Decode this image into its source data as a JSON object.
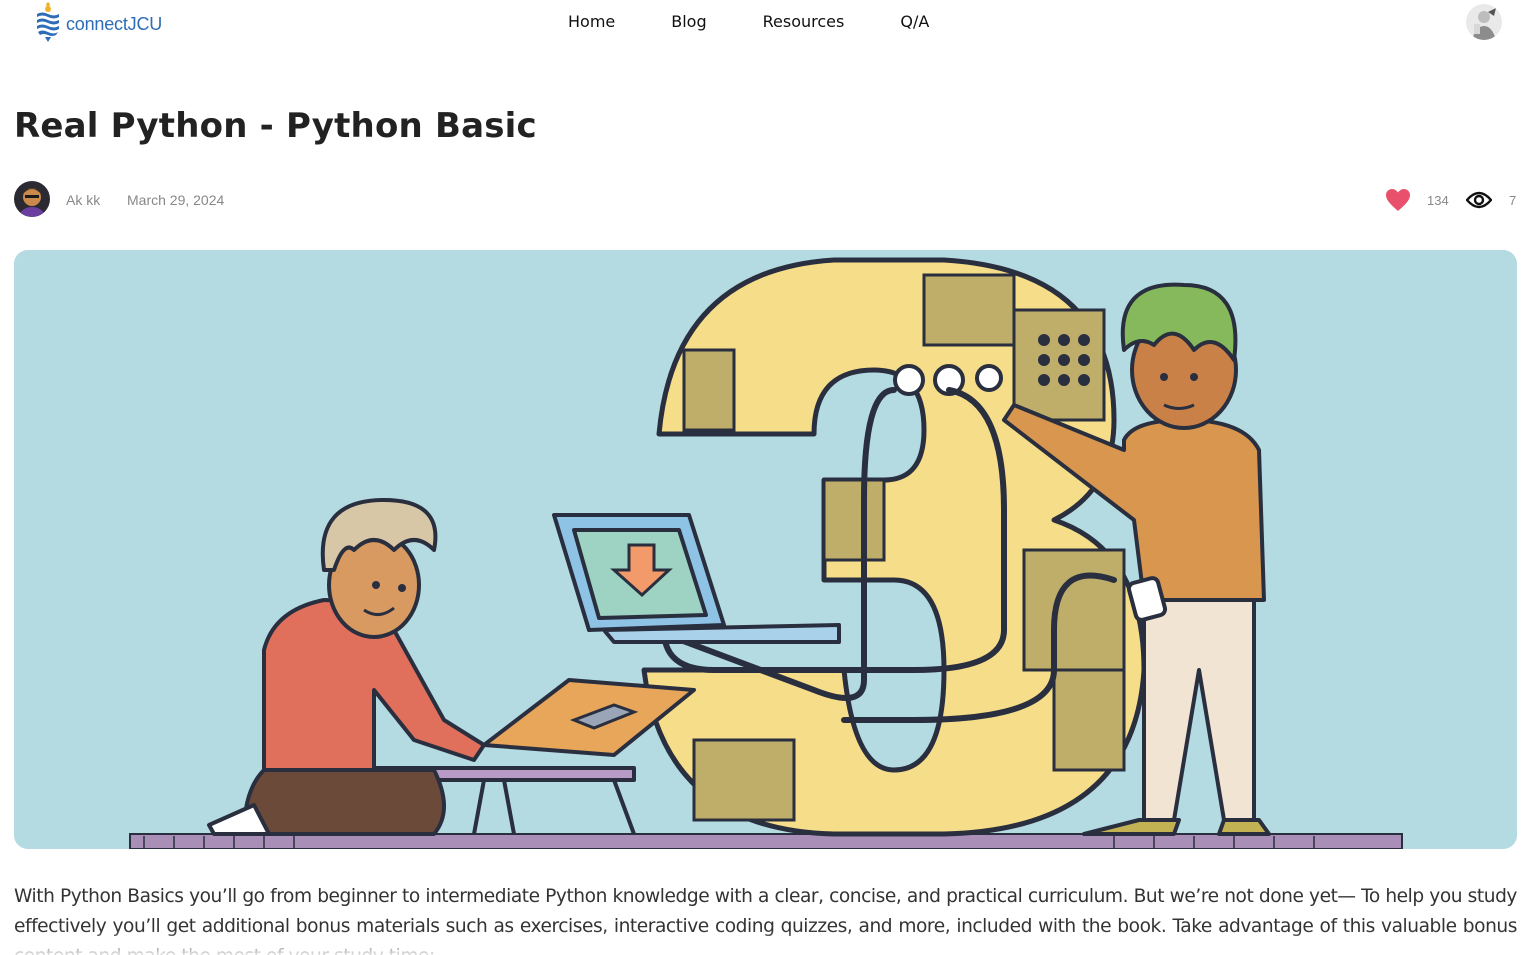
{
  "brand": {
    "name": "connectJCU",
    "color": "#2d6db7"
  },
  "nav": {
    "items": [
      {
        "label": "Home"
      },
      {
        "label": "Blog"
      },
      {
        "label": "Resources"
      },
      {
        "label": "Q/A"
      }
    ]
  },
  "post": {
    "title": "Real Python - Python Basic",
    "author": "Ak kk",
    "date": "March 29, 2024",
    "likes": "134",
    "views": "7",
    "body": "With Python Basics you’ll go from beginner to intermediate Python knowledge with a clear, concise, and practical curriculum. But we’re not done yet— To help you study effectively you’ll get additional bonus materials such as exercises, interactive coding quizzes, and more, included with the book. Take advantage of this valuable bonus content and make the most of your study time:"
  },
  "icons": {
    "like": "heart-icon",
    "views": "eye-icon",
    "logo": "wave-shield-logo"
  },
  "colors": {
    "like": "#e8506b",
    "hero_background": "#b3dbe1"
  }
}
